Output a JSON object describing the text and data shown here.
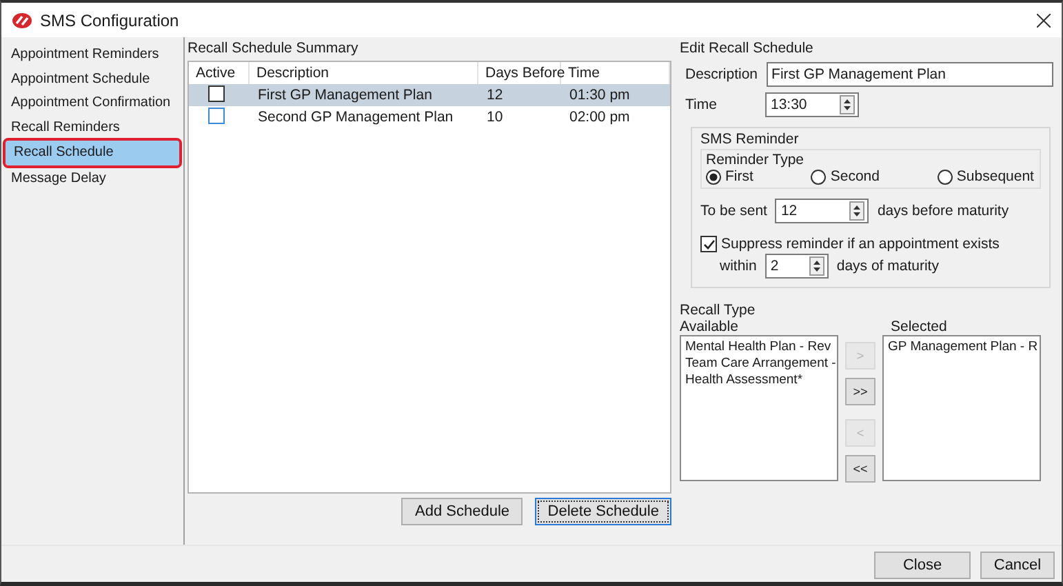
{
  "window": {
    "title": "SMS Configuration"
  },
  "sidebar": {
    "items": [
      {
        "label": "Appointment Reminders",
        "selected": false
      },
      {
        "label": "Appointment Schedule",
        "selected": false
      },
      {
        "label": "Appointment Confirmation",
        "selected": false
      },
      {
        "label": "Recall Reminders",
        "selected": false
      },
      {
        "label": "Recall Schedule",
        "selected": true
      },
      {
        "label": "Message Delay",
        "selected": false
      }
    ]
  },
  "summary": {
    "title": "Recall Schedule Summary",
    "columns": [
      "Active",
      "Description",
      "Days Before",
      "Time"
    ],
    "rows": [
      {
        "active": false,
        "description": "First GP Management Plan",
        "days_before": "12",
        "time": "01:30 pm",
        "selected": true
      },
      {
        "active": false,
        "description": "Second GP Management Plan",
        "days_before": "10",
        "time": "02:00 pm",
        "selected": false
      }
    ],
    "buttons": [
      {
        "label": "Add Schedule",
        "focused": false
      },
      {
        "label": "Delete Schedule",
        "focused": true
      }
    ]
  },
  "edit": {
    "title": "Edit Recall Schedule",
    "description_label": "Description",
    "description": "First GP Management Plan",
    "time_label": "Time",
    "time": "13:30",
    "sms_reminder": {
      "title": "SMS Reminder",
      "reminder_type_label": "Reminder Type",
      "options": [
        {
          "label": "First",
          "selected": true
        },
        {
          "label": "Second",
          "selected": false
        },
        {
          "label": "Subsequent",
          "selected": false
        }
      ],
      "to_be_sent_label": "To be sent",
      "to_be_sent": "12",
      "to_be_sent_suffix": "days before maturity",
      "suppress": {
        "label": "Suppress reminder if an appointment exists",
        "checked": true
      },
      "within_label": "within",
      "within": "2",
      "within_suffix": "days of maturity"
    }
  },
  "recall_type": {
    "title": "Recall Type",
    "available_label": "Available",
    "available": [
      "Mental Health Plan - Rev",
      "Team Care Arrangement -",
      "Health Assessment*"
    ],
    "selected_label": "Selected",
    "selected": [
      "GP Management Plan - R"
    ],
    "move_buttons": [
      {
        "label": ">",
        "disabled": true
      },
      {
        "label": ">>",
        "disabled": false
      },
      {
        "label": "<",
        "disabled": true
      },
      {
        "label": "<<",
        "disabled": false
      }
    ]
  },
  "footer_buttons": [
    "Close",
    "Cancel"
  ]
}
